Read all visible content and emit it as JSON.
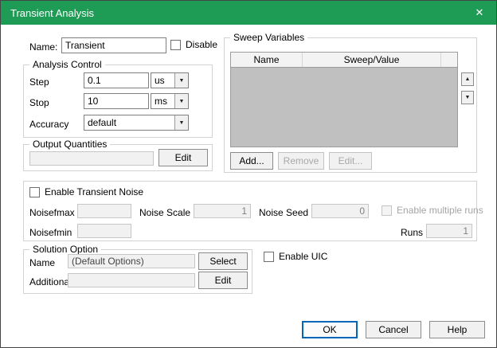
{
  "window": {
    "title": "Transient Analysis",
    "close_icon": "✕"
  },
  "top": {
    "name_label": "Name:",
    "name_value": "Transient",
    "disable_label": "Disable"
  },
  "analysis_control": {
    "title": "Analysis Control",
    "step_label": "Step",
    "step_value": "0.1",
    "step_unit": "us",
    "stop_label": "Stop",
    "stop_value": "10",
    "stop_unit": "ms",
    "accuracy_label": "Accuracy",
    "accuracy_value": "default"
  },
  "output_quantities": {
    "title": "Output Quantities",
    "value": "",
    "edit_button": "Edit"
  },
  "sweep_variables": {
    "title": "Sweep Variables",
    "columns": [
      "Name",
      "Sweep/Value"
    ],
    "rows": [],
    "add_button": "Add...",
    "remove_button": "Remove",
    "edit_button": "Edit..."
  },
  "noise": {
    "enable_label": "Enable Transient Noise",
    "noisefmax_label": "Noisefmax",
    "noisefmax_value": "",
    "noise_scale_label": "Noise Scale",
    "noise_scale_value": "1",
    "noise_seed_label": "Noise Seed",
    "noise_seed_value": "0",
    "enable_multiple_runs_label": "Enable multiple runs",
    "noisefmin_label": "Noisefmin",
    "noisefmin_value": "",
    "runs_label": "Runs",
    "runs_value": "1"
  },
  "solution_option": {
    "title": "Solution Option",
    "name_label": "Name",
    "name_value": "(Default Options)",
    "select_button": "Select",
    "additional_label": "Additional",
    "additional_value": "",
    "edit_button": "Edit"
  },
  "enable_uic_label": "Enable UIC",
  "footer": {
    "ok": "OK",
    "cancel": "Cancel",
    "help": "Help"
  },
  "icons": {
    "dropdown": "▼",
    "up": "▲",
    "down": "▼"
  }
}
